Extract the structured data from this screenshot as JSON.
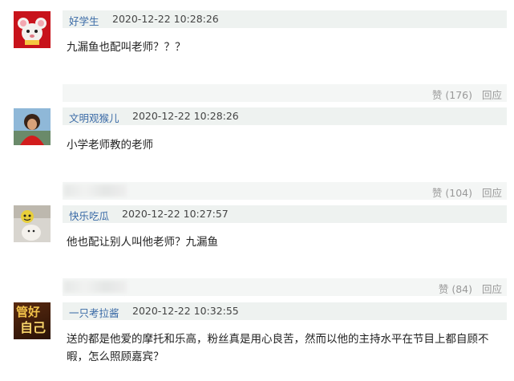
{
  "comments": [
    {
      "username": "好学生",
      "time": "2020-12-22 10:28:26",
      "content": "九漏鱼也配叫老师？？？",
      "likes": "赞 (176)",
      "reply": "回应"
    },
    {
      "username": "文明观猴儿",
      "time": "2020-12-22 10:28:26",
      "content": "小学老师教的老师",
      "likes": "赞 (104)",
      "reply": "回应"
    },
    {
      "username": "快乐吃瓜",
      "time": "2020-12-22 10:27:57",
      "content": "他也配让别人叫他老师？九漏鱼",
      "likes": "赞 (84)",
      "reply": "回应"
    },
    {
      "username": "一只考拉酱",
      "time": "2020-12-22 10:32:55",
      "content_line1": "送的都是他爱的摩托和乐高，粉丝真是用心良苦，然而以他的主持水平在节目上都自顾不",
      "content_line2": "暇，怎么照顾嘉宾？",
      "avatar_text_1": "管好",
      "avatar_text_2": "自己"
    }
  ]
}
